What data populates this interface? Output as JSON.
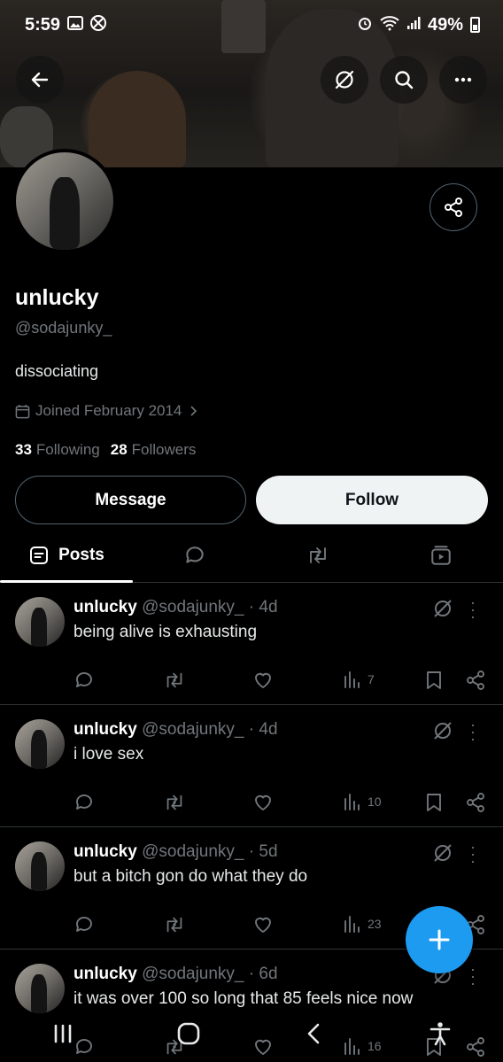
{
  "status_bar": {
    "time": "5:59",
    "battery": "49%",
    "left_icons": [
      "gallery-icon",
      "xbox-icon"
    ],
    "right_icons": [
      "alarm-icon",
      "wifi-icon",
      "signal-icon",
      "battery-icon"
    ]
  },
  "profile": {
    "name": "unlucky",
    "handle": "@sodajunky_",
    "bio": "dissociating",
    "joined": "Joined February 2014",
    "following_count": "33",
    "following_label": "Following",
    "followers_count": "28",
    "followers_label": "Followers"
  },
  "buttons": {
    "message": "Message",
    "follow": "Follow"
  },
  "tabs": {
    "posts": "Posts"
  },
  "posts": [
    {
      "name": "unlucky",
      "handle": "@sodajunky_",
      "time": "· 4d",
      "text": "being alive is exhausting",
      "views": "7"
    },
    {
      "name": "unlucky",
      "handle": "@sodajunky_",
      "time": "· 4d",
      "text": "i love sex",
      "views": "10"
    },
    {
      "name": "unlucky",
      "handle": "@sodajunky_",
      "time": "· 5d",
      "text": "but a bitch gon do what they do",
      "views": "23"
    },
    {
      "name": "unlucky",
      "handle": "@sodajunky_",
      "time": "· 6d",
      "text": "it was over 100 so long that 85 feels nice now",
      "views": "16"
    }
  ],
  "colors": {
    "accent": "#1d9bf0",
    "background": "#000000",
    "muted": "#71767b",
    "border": "#2f3336"
  }
}
